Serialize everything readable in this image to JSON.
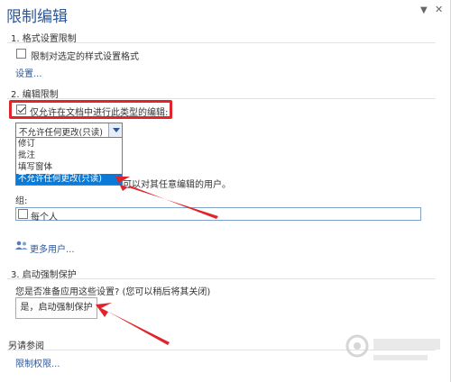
{
  "pane": {
    "title": "限制编辑",
    "pin_icon": "chevron-down-icon",
    "close_icon": "close-icon"
  },
  "format": {
    "heading": "1. 格式设置限制",
    "checkbox_label": "限制对选定的样式设置格式",
    "checked": false,
    "settings_link": "设置..."
  },
  "editing": {
    "heading": "2. 编辑限制",
    "checkbox_label": "仅允许在文档中进行此类型的编辑:",
    "checked": true,
    "select_value": "不允许任何更改(只读)",
    "options": [
      "修订",
      "批注",
      "填写窗体",
      "不允许任何更改(只读)"
    ],
    "selected_index": 3,
    "hidden_text": "可以对其任意编辑的用户。",
    "group_label": "组:",
    "group_item": "每个人",
    "group_checked": false,
    "more_users": "更多用户..."
  },
  "enforce": {
    "heading": "3. 启动强制保护",
    "question": "您是否准备应用这些设置? (您可以稍后将其关闭)",
    "button": "是，启动强制保护"
  },
  "see_also": {
    "heading": "另请参阅",
    "link": "限制权限..."
  },
  "colors": {
    "accent": "#2b579a",
    "annotation_red": "#e0242a",
    "selection_blue": "#0a7ad6"
  }
}
